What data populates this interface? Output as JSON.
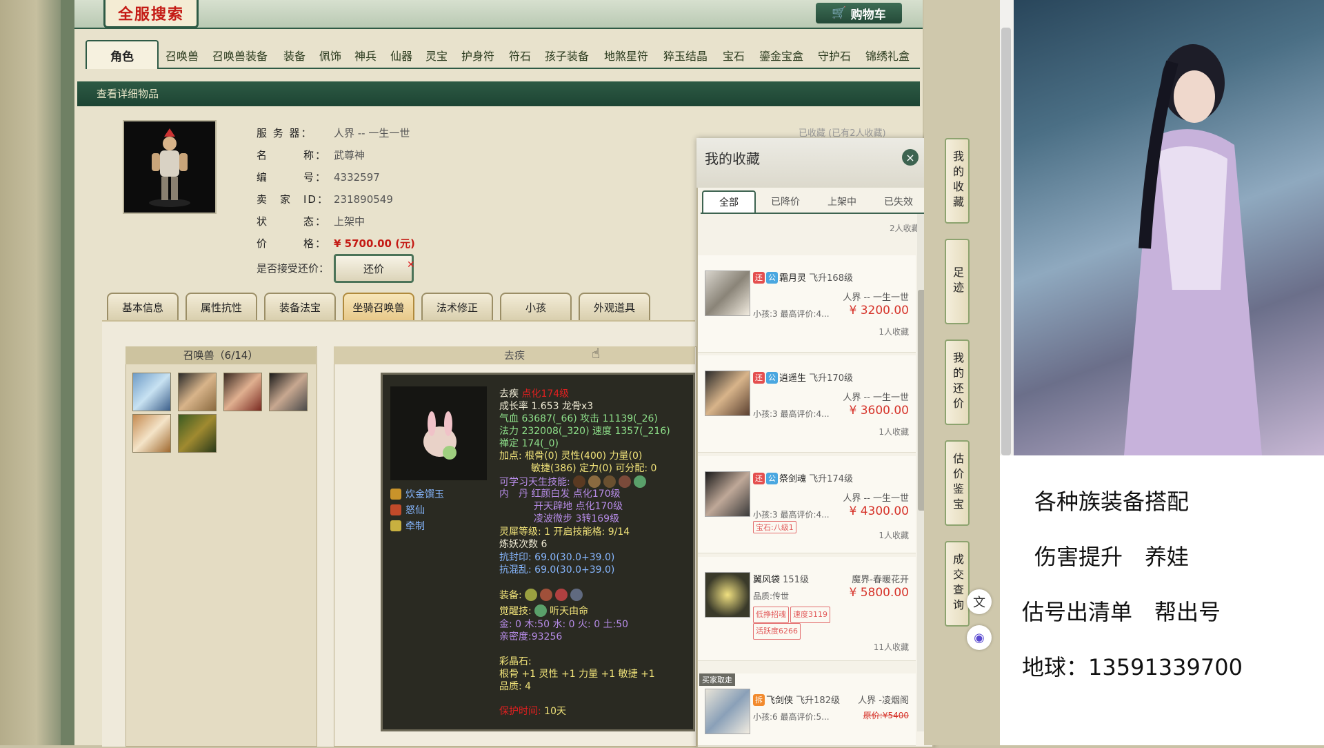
{
  "header": {
    "logo": "全服搜索",
    "cart_label": "购物车"
  },
  "categories": [
    "角色",
    "召唤兽",
    "召唤兽装备",
    "装备",
    "佩饰",
    "神兵",
    "仙器",
    "灵宝",
    "护身符",
    "符石",
    "孩子装备",
    "地煞星符",
    "猝玉结晶",
    "宝石",
    "鎏金宝盒",
    "守护石",
    "锦绣礼盒"
  ],
  "detail_bar": "查看详细物品",
  "info": {
    "server_label": "服 务 器：",
    "server": "人界 -- 一生一世",
    "name_label": "名　　　称：",
    "name": "武尊神",
    "id_label": "编　　　号：",
    "id": "4332597",
    "seller_label": "卖　家　ID：",
    "seller": "231890549",
    "status_label": "状　　　态：",
    "status": "上架中",
    "price_label": "价　　　格：",
    "price": "¥ 5700.00 (元)",
    "bargain_label": "是否接受还价：",
    "bargain_button": "还价",
    "favorited": "已收藏 (已有2人收藏)"
  },
  "tabs": [
    "基本信息",
    "属性抗性",
    "装备法宝",
    "坐骑召唤兽",
    "法术修正",
    "小孩",
    "外观道具"
  ],
  "pets": {
    "title": "召唤兽（6/14）"
  },
  "pet_detail": {
    "title": "去疾",
    "name": "去疾",
    "level": "点化174级",
    "growth": "成长率 1.653  龙骨x3",
    "hp": "气血 63687(_66) 攻击 11139(_26)",
    "mp": "法力 232008(_320) 速度 1357(_216)",
    "calm": "禅定 174(_0)",
    "points1": "加点:  根骨(0) 灵性(400) 力量(0)",
    "points2": "敏捷(386) 定力(0) 可分配: 0",
    "skills_label": "可学习天生技能:",
    "inner1": "内　丹 红颜白发 点化170级",
    "inner2": "开天辟地 点化170级",
    "inner3": "凌波微步 3转169级",
    "spirit": "灵犀等级: 1 开启技能格: 9/14",
    "refine": "炼妖次数 6",
    "resist1": "抗封印: 69.0(30.0+39.0)",
    "resist2": "抗混乱: 69.0(30.0+39.0)",
    "equip_label": "装备:",
    "awaken_label": "觉醒技:",
    "awaken": "听天由命",
    "elements": "金: 0 木:50 水: 0 火: 0 土:50",
    "intimacy": "亲密度:93256",
    "crystal_label": "彩晶石:",
    "crystal": "根骨 +1 灵性 +1 力量 +1 敏捷 +1",
    "quality": "品质: 4",
    "protect_label": "保护时间:",
    "protect": "10天",
    "skills": [
      "炊金馔玉",
      "怒仙",
      "牵制"
    ]
  },
  "favorites": {
    "title": "我的收藏",
    "close": "×",
    "tabs": [
      "全部",
      "已降价",
      "上架中",
      "已失效"
    ],
    "top_count": "2人收藏",
    "items": [
      {
        "name": "霜月灵",
        "level": "飞升168级",
        "server": "人界 -- 一生一世",
        "kid": "小孩:3 最高评价:4...",
        "price": "¥ 3200.00",
        "count": "1人收藏"
      },
      {
        "name": "逍遥生",
        "level": "飞升170级",
        "server": "人界 -- 一生一世",
        "kid": "小孩:3 最高评价:4...",
        "price": "¥ 3600.00",
        "count": "1人收藏"
      },
      {
        "name": "祭剑魂",
        "level": "飞升174级",
        "server": "人界 -- 一生一世",
        "kid": "小孩:3 最高评价:4...",
        "price": "¥ 4300.00",
        "count": "1人收藏",
        "tag": "宝石:八级1"
      },
      {
        "name": "翼风袋",
        "level": "151级",
        "server": "魔界-春暖花开",
        "kid": "品质:传世",
        "price": "¥ 5800.00",
        "count": "11人收藏",
        "tags": [
          "低挣招魂",
          "速度3119",
          "活跃度6266"
        ]
      },
      {
        "name": "飞剑侠",
        "level": "飞升182级",
        "server": "人界 -凌烟阁",
        "kid": "小孩:6 最高评价:5...",
        "price": "原价:¥5400",
        "ribbon": "买家取走"
      }
    ]
  },
  "right_nav": [
    "我的收藏",
    "足迹",
    "我的还价",
    "估价鉴宝",
    "成交查询"
  ],
  "ad": {
    "line1": "各种族装备搭配",
    "line2": "伤害提升　养娃",
    "line3": "估号出清单　帮出号",
    "line4": "地球：13591339700"
  }
}
